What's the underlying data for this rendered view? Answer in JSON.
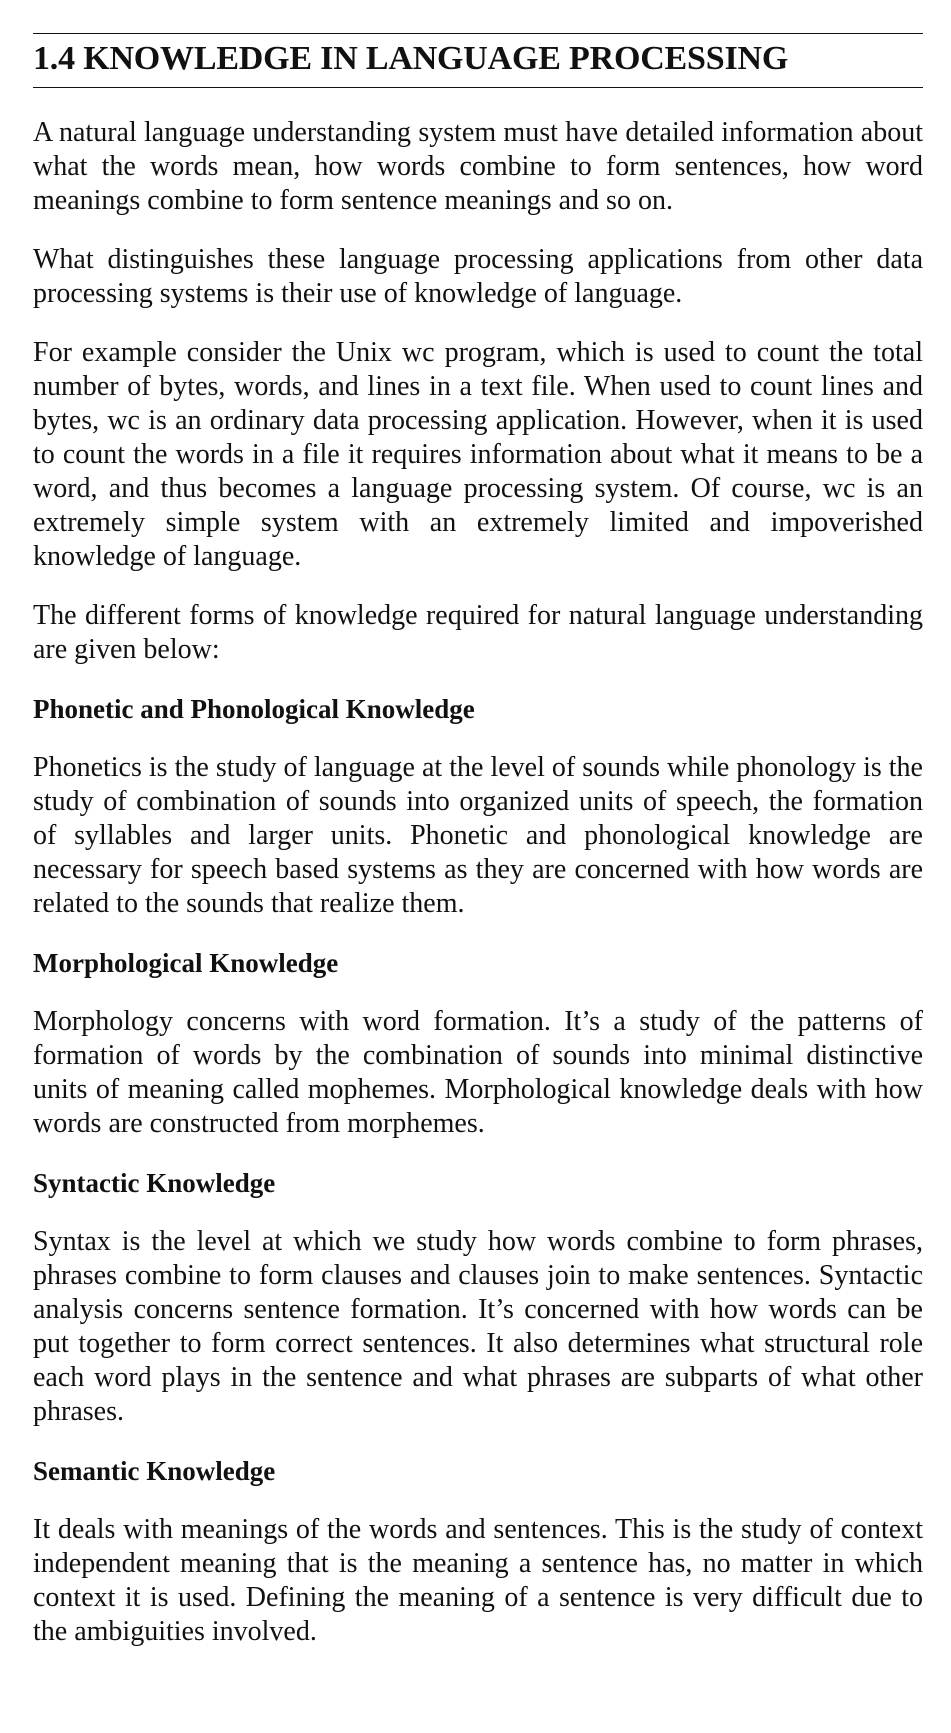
{
  "section": {
    "title": "1.4 KNOWLEDGE IN LANGUAGE PROCESSING"
  },
  "intro": [
    "A natural language understanding system must have detailed information about what the words mean, how words combine to form sentences, how word meanings combine to form sentence meanings and so on.",
    "What distinguishes these language processing applications from other data processing systems is their use of knowledge of language.",
    "For example consider the Unix wc program, which is used to count the total number of bytes, words, and lines in a text file. When used to count lines and bytes, wc is an ordinary data processing application. However, when it is used to count the words in a file it requires information about what it means to be a word, and thus becomes a language processing system. Of course, wc is an extremely simple system with an extremely limited and impoverished knowledge of language.",
    "The different forms of knowledge required for natural language understanding are given below:"
  ],
  "knowledge_types": [
    {
      "heading": "Phonetic and Phonological Knowledge",
      "text": "Phonetics is the study of language at the level of sounds while phonology is the study of combination of sounds into organized units of speech, the formation of syllables and larger units. Phonetic and phonological knowledge are necessary for speech based systems as they are concerned with how words are related to the sounds that realize them."
    },
    {
      "heading": "Morphological Knowledge",
      "text": "Morphology concerns with word formation. It’s a study of the patterns of formation of words by the combination of sounds into minimal distinctive units of meaning called mophemes. Morphological knowledge deals with how words are constructed from morphemes."
    },
    {
      "heading": "Syntactic Knowledge",
      "text": "Syntax is the level at which we study how words combine to form phrases, phrases combine to form clauses and clauses join to make sentences. Syntactic analysis concerns sentence formation. It’s concerned with how words can be put together to form correct sentences. It also determines what structural role each word plays in the sentence and what phrases are subparts of what other phrases."
    },
    {
      "heading": "Semantic Knowledge",
      "text": "It deals with meanings of the words and sentences. This is the study of context independent meaning that is the meaning a sentence has, no matter in which context it is used. Defining the meaning of a sentence is very difficult due to the ambiguities involved."
    }
  ]
}
